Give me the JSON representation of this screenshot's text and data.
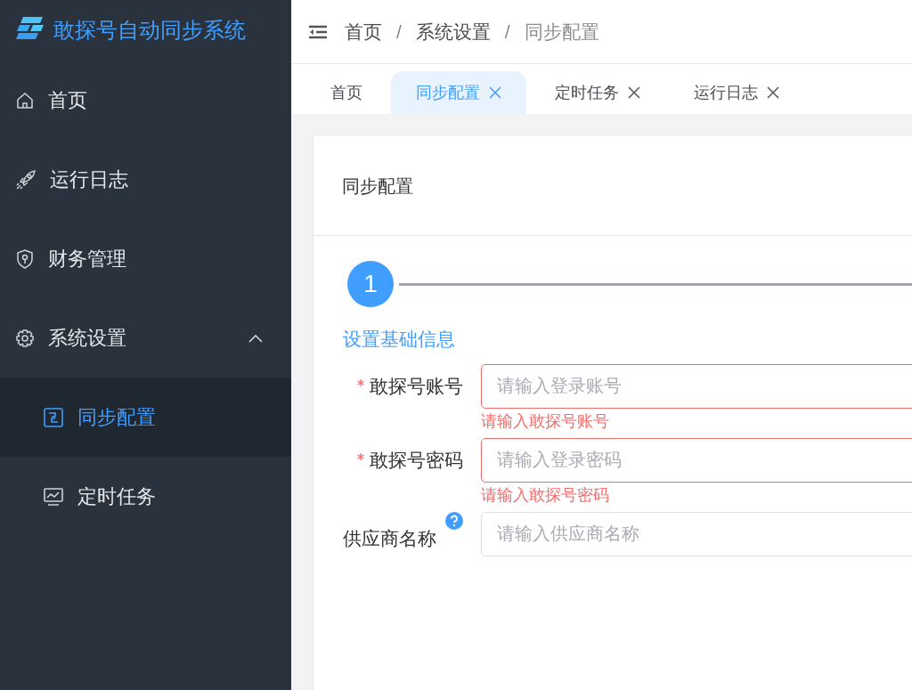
{
  "sidebar": {
    "logo_title": "敢探号自动同步系统",
    "items": [
      {
        "label": "首页",
        "selected": false
      },
      {
        "label": "运行日志",
        "selected": false
      },
      {
        "label": "财务管理",
        "selected": false
      },
      {
        "label": "系统设置",
        "selected": false,
        "expanded": true,
        "children": [
          {
            "label": "同步配置",
            "selected": true
          },
          {
            "label": "定时任务",
            "selected": false
          }
        ]
      }
    ]
  },
  "header": {
    "breadcrumb": [
      "首页",
      "系统设置",
      "同步配置"
    ],
    "separator": "/"
  },
  "tabs": [
    {
      "label": "首页",
      "selected": false,
      "closable": false
    },
    {
      "label": "同步配置",
      "selected": true,
      "closable": true
    },
    {
      "label": "定时任务",
      "selected": false,
      "closable": true
    },
    {
      "label": "运行日志",
      "selected": false,
      "closable": true
    }
  ],
  "card": {
    "title": "同步配置",
    "step": {
      "number": "1",
      "active": true
    },
    "section_title": "设置基础信息",
    "fields": [
      {
        "label": "敢探号账号",
        "required": true,
        "placeholder": "请输入登录账号",
        "error": "请输入敢探号账号",
        "help": false
      },
      {
        "label": "敢探号密码",
        "required": true,
        "placeholder": "请输入登录密码",
        "error": "请输入敢探号密码",
        "help": false
      },
      {
        "label": "供应商名称",
        "required": false,
        "placeholder": "请输入供应商名称",
        "help": true
      }
    ]
  }
}
